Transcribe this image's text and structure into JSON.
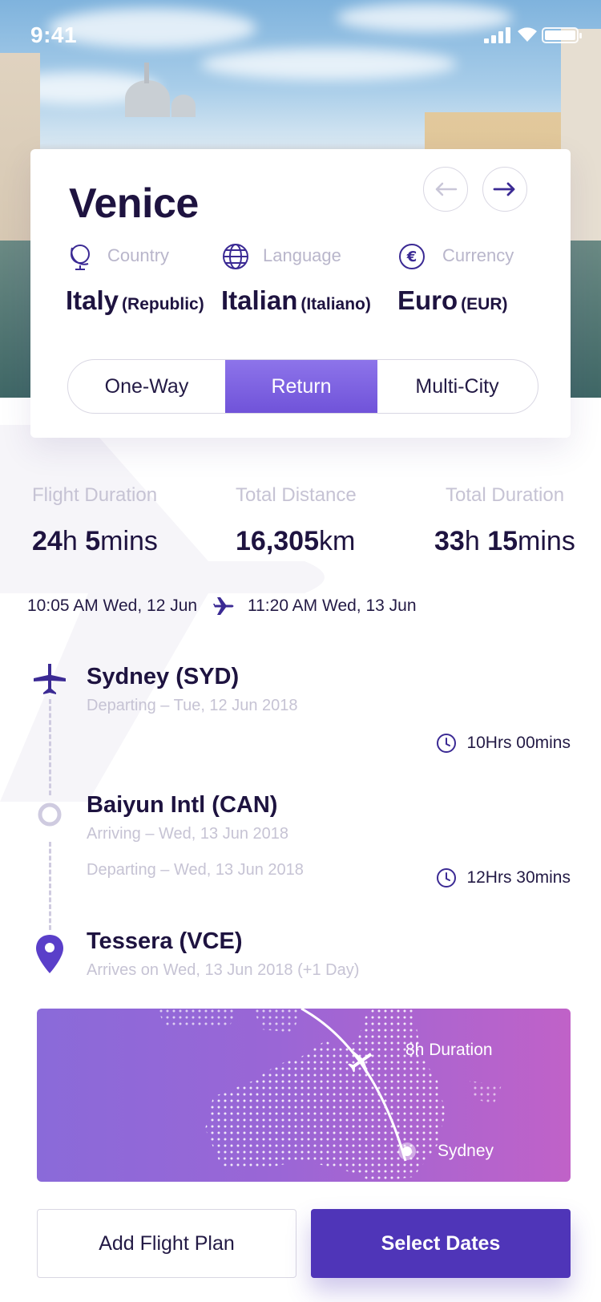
{
  "status_bar": {
    "time": "9:41"
  },
  "destination": {
    "city": "Venice",
    "country": {
      "label": "Country",
      "value": "Italy",
      "detail": "(Republic)",
      "icon": "globe-stand-icon"
    },
    "language": {
      "label": "Language",
      "value": "Italian",
      "detail": "(Italiano)",
      "icon": "globe-icon"
    },
    "currency": {
      "label": "Currency",
      "value": "Euro",
      "detail": "(EUR)",
      "icon": "euro-icon"
    }
  },
  "trip_type": {
    "options": [
      "One-Way",
      "Return",
      "Multi-City"
    ],
    "selected": "Return",
    "accent": "#7a5fe0"
  },
  "stats": {
    "flight_duration": {
      "label": "Flight Duration",
      "h": "24",
      "h_unit": "h",
      "m": "5",
      "m_unit": "mins"
    },
    "total_distance": {
      "label": "Total Distance",
      "value": "16,305",
      "unit": "km"
    },
    "total_duration": {
      "label": "Total Duration",
      "h": "33",
      "h_unit": "h",
      "m": "15",
      "m_unit": "mins"
    }
  },
  "times": {
    "depart": "10:05 AM Wed, 12 Jun",
    "arrive": "11:20 AM Wed, 13 Jun"
  },
  "itinerary": {
    "origin": {
      "name": "Sydney (SYD)",
      "sub": "Departing  – Tue, 12 Jun 2018"
    },
    "leg1_duration": "10Hrs 00mins",
    "stopover": {
      "name": "Baiyun Intl (CAN)",
      "arriving": "Arriving  – Wed, 13 Jun 2018",
      "departing": "Departing  – Wed, 13 Jun 2018"
    },
    "leg2_duration": "12Hrs 30mins",
    "destination": {
      "name": "Tessera (VCE)",
      "sub": "Arrives on Wed, 13 Jun 2018 (+1 Day)"
    }
  },
  "map": {
    "duration_label": "8h Duration",
    "city_label": "Sydney"
  },
  "actions": {
    "add_plan": "Add Flight Plan",
    "select_dates": "Select Dates"
  },
  "colors": {
    "primary": "#4f35b8",
    "text": "#1e1340",
    "muted": "#c6c3d4"
  }
}
